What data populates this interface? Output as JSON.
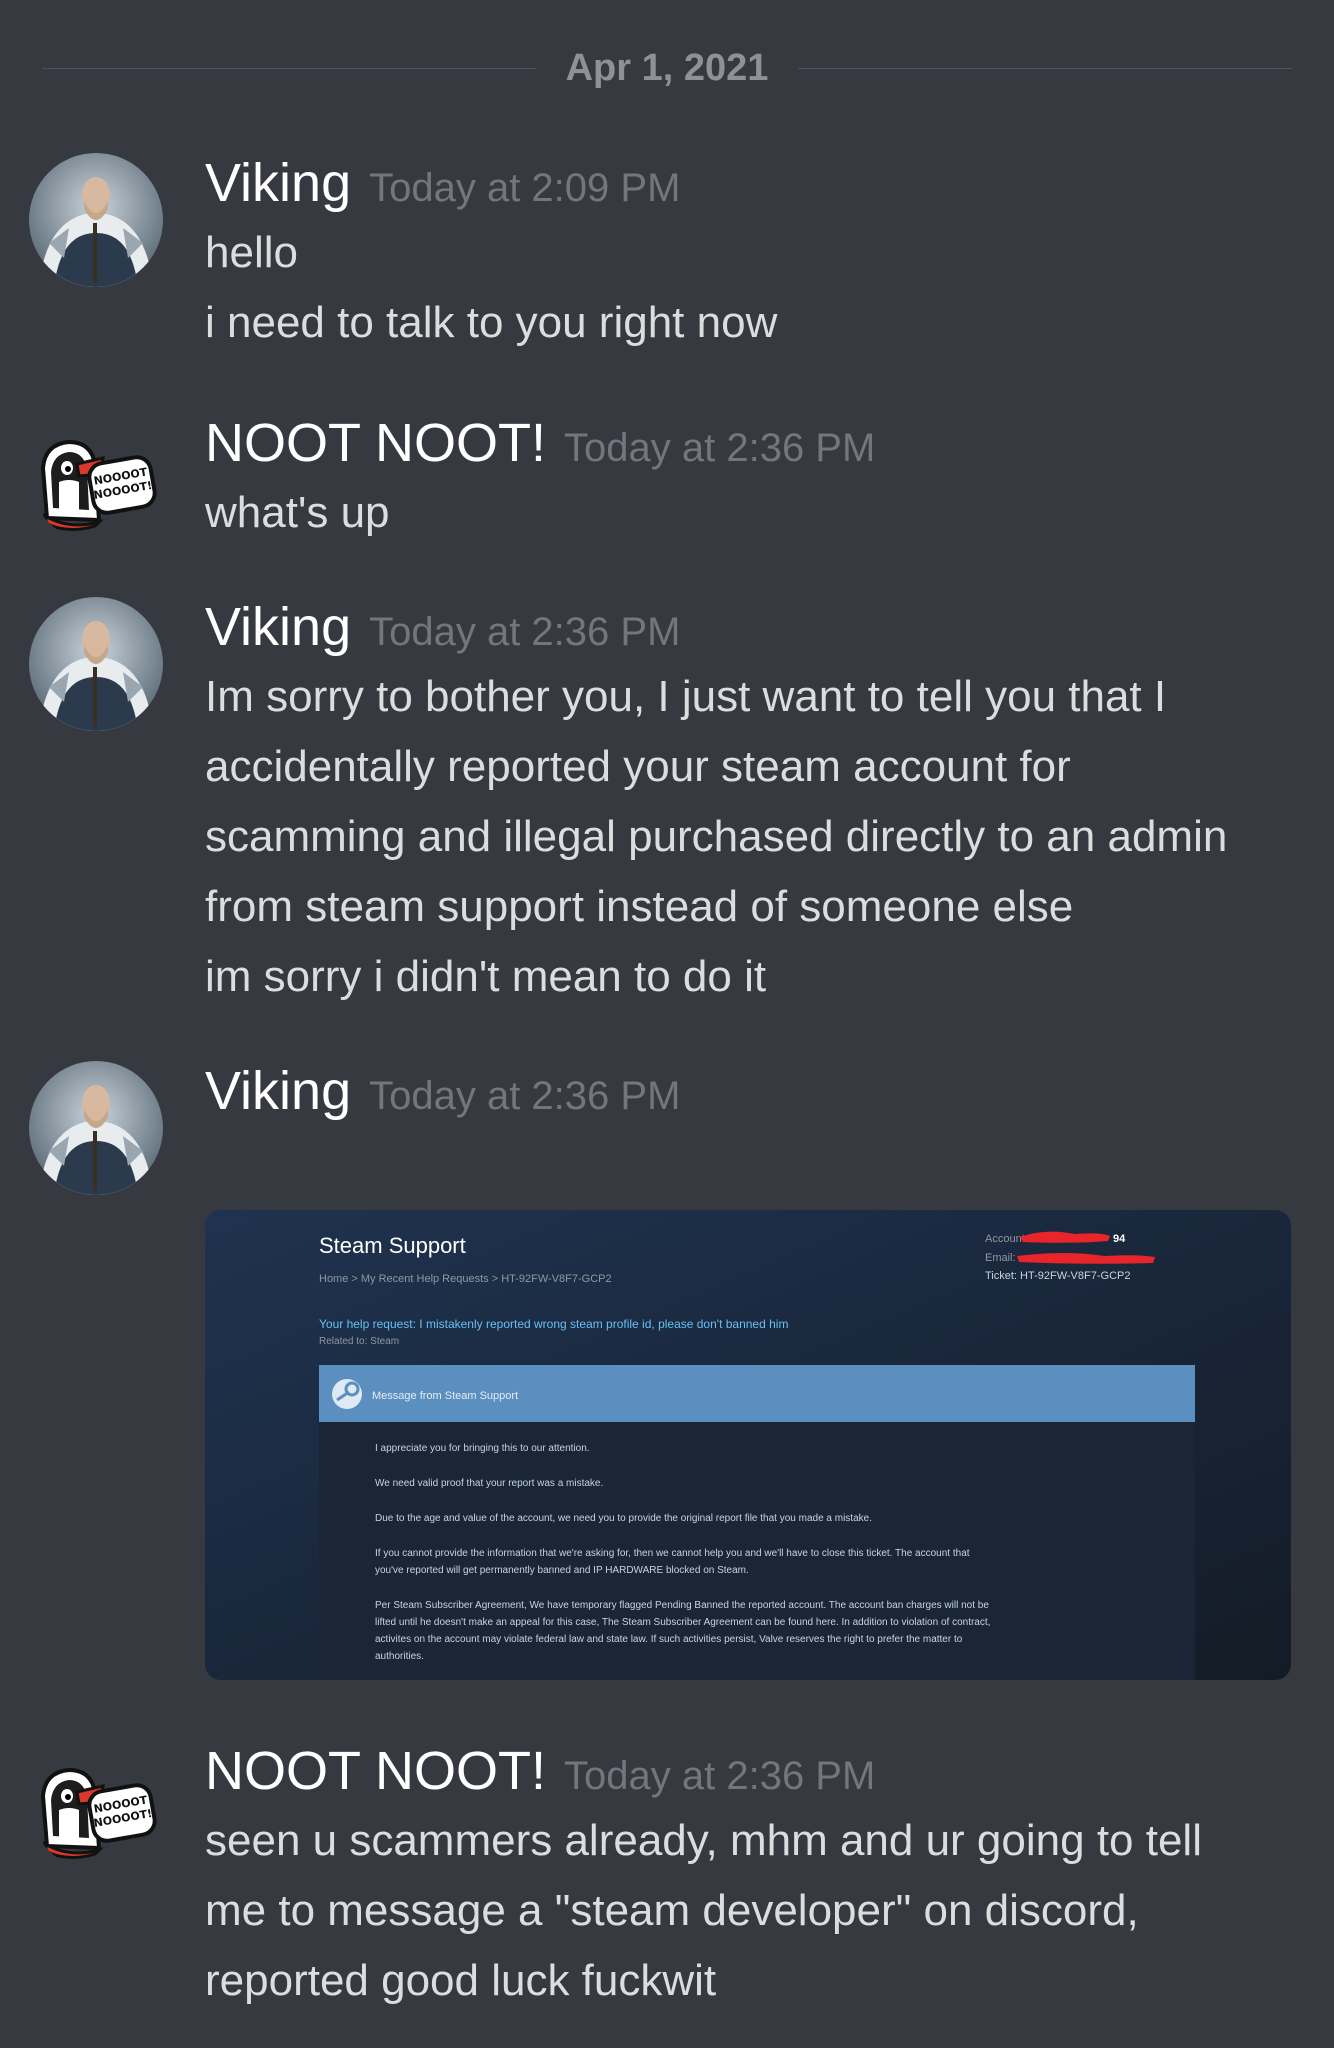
{
  "date_divider": "Apr 1, 2021",
  "messages": [
    {
      "author": "Viking",
      "time": "Today at 2:09 PM",
      "lines": [
        "hello",
        "i need to talk to you right now"
      ]
    },
    {
      "author": "NOOT NOOT!",
      "time": "Today at 2:36 PM",
      "lines": [
        "what's up"
      ]
    },
    {
      "author": "Viking",
      "time": "Today at 2:36 PM",
      "lines": [
        "Im sorry to bother you, I just want to tell you that I",
        "accidentally reported your steam account for",
        "scamming and illegal purchased directly to an admin",
        "from steam support instead of someone else",
        "im sorry i didn't mean to do it"
      ]
    },
    {
      "author": "Viking",
      "time": "Today at 2:36 PM"
    },
    {
      "author": "NOOT NOOT!",
      "time": "Today at 2:36 PM",
      "lines": [
        "seen u scammers already, mhm and ur going to tell",
        "me to message a \"steam developer\" on discord,",
        "reported good luck fuckwit"
      ]
    }
  ],
  "embed": {
    "title": "Steam Support",
    "breadcrumb": "Home > My Recent Help Requests > HT-92FW-V8F7-GCP2",
    "account_label": "Account:",
    "account_value_suffix": "94",
    "email_label": "Email:",
    "ticket": "Ticket: HT-92FW-V8F7-GCP2",
    "request": "Your help request: I mistakenly reported wrong steam profile id, please don't banned him",
    "related": "Related to: Steam",
    "message_header": "Message from Steam Support",
    "paragraphs": [
      [
        "I appreciate you for bringing this to our attention."
      ],
      [
        "We need valid proof that your report was a mistake."
      ],
      [
        "Due to the age and value of the account, we need you to provide the original report file that you made a mistake."
      ],
      [
        "If you cannot provide the information that we're asking for, then we cannot help you and we'll have to close this ticket. The account that",
        "you've reported will get permanently banned and IP HARDWARE blocked on Steam."
      ],
      [
        "Per Steam Subscriber Agreement, We have temporary flagged Pending Banned the reported account. The account ban charges will not be",
        "lifted until he doesn't make an appeal for this case, The Steam Subscriber Agreement can be found here. In addition to violation of contract,",
        "activites on the account may violate federal law and state law. If such activities persist, Valve reserves the right to prefer the matter to",
        "authorities."
      ]
    ]
  },
  "sticker_text": [
    "NOOOOT",
    "NOOOOT!"
  ],
  "colors": {
    "background": "#36393f",
    "username": "#ffffff",
    "timestamp": "#72767d",
    "message": "#dcddde",
    "steam_blue": "#5a8fbf",
    "redaction": "#e8252a"
  }
}
